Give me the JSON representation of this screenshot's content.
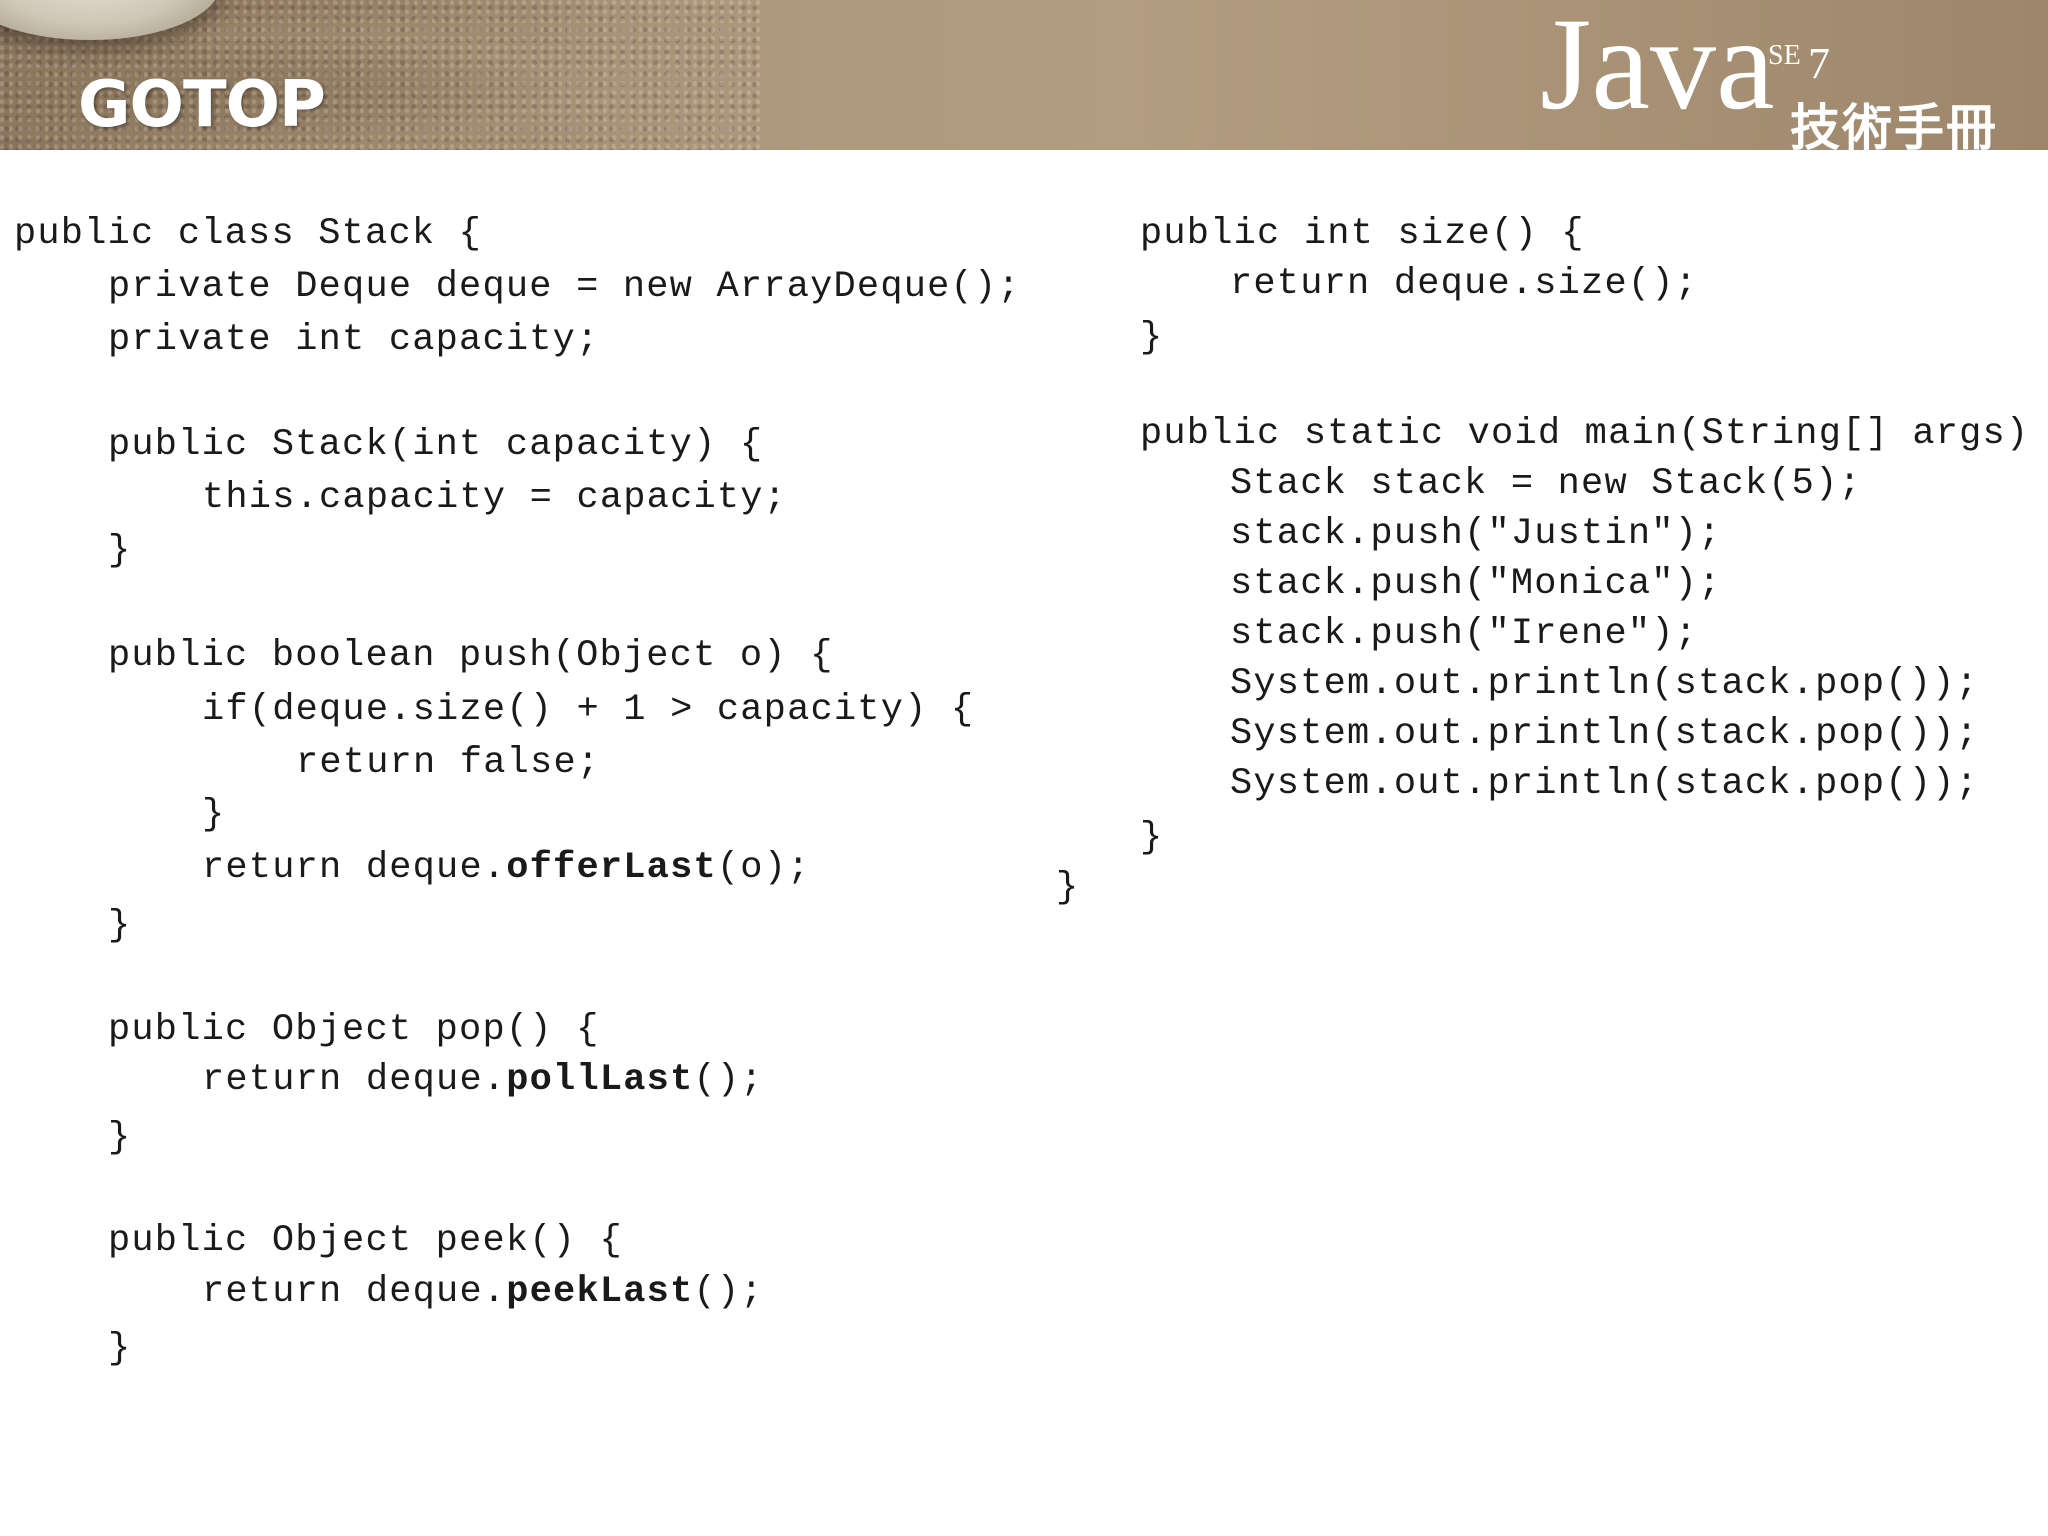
{
  "header": {
    "brand": "GOTOP",
    "product": "Java",
    "edition": "SE",
    "version": "7",
    "subtitle": "技術手冊"
  },
  "left_code": [
    {
      "indent": 0,
      "parts": [
        {
          "t": "public class Stack {"
        }
      ]
    },
    {
      "indent": 1,
      "parts": [
        {
          "t": "private Deque deque = new ArrayDeque();"
        }
      ]
    },
    {
      "indent": 1,
      "parts": [
        {
          "t": "private int capacity;"
        }
      ]
    },
    {
      "indent": 1,
      "parts": [
        {
          "t": "public Stack(int capacity) {"
        }
      ]
    },
    {
      "indent": 2,
      "parts": [
        {
          "t": "this.capacity = capacity;"
        }
      ]
    },
    {
      "indent": 1,
      "parts": [
        {
          "t": "}"
        }
      ]
    },
    {
      "indent": 1,
      "parts": [
        {
          "t": "public boolean push(Object o) {"
        }
      ]
    },
    {
      "indent": 2,
      "parts": [
        {
          "t": "if(deque.size() + 1 > capacity) {"
        }
      ]
    },
    {
      "indent": 3,
      "parts": [
        {
          "t": "return false;"
        }
      ]
    },
    {
      "indent": 2,
      "parts": [
        {
          "t": "}"
        }
      ]
    },
    {
      "indent": 2,
      "parts": [
        {
          "t": "return deque."
        },
        {
          "t": "offerLast",
          "b": true
        },
        {
          "t": "(o);"
        }
      ]
    },
    {
      "indent": 1,
      "parts": [
        {
          "t": "}"
        }
      ]
    },
    {
      "indent": 1,
      "parts": [
        {
          "t": "public Object pop() {"
        }
      ]
    },
    {
      "indent": 2,
      "parts": [
        {
          "t": "return deque."
        },
        {
          "t": "pollLast",
          "b": true
        },
        {
          "t": "();"
        }
      ]
    },
    {
      "indent": 1,
      "parts": [
        {
          "t": "}"
        }
      ]
    },
    {
      "indent": 1,
      "parts": [
        {
          "t": "public Object peek() {"
        }
      ]
    },
    {
      "indent": 2,
      "parts": [
        {
          "t": "return deque."
        },
        {
          "t": "peekLast",
          "b": true
        },
        {
          "t": "();"
        }
      ]
    },
    {
      "indent": 1,
      "parts": [
        {
          "t": "}"
        }
      ]
    }
  ],
  "right_code": [
    {
      "indent": 0,
      "parts": [
        {
          "t": "public int size() {"
        }
      ]
    },
    {
      "indent": 1,
      "parts": [
        {
          "t": "return deque.size();"
        }
      ]
    },
    {
      "indent": 0,
      "parts": [
        {
          "t": "}"
        }
      ]
    },
    {
      "indent": 0,
      "parts": [
        {
          "t": "public static void main(String[] args) {"
        }
      ]
    },
    {
      "indent": 1,
      "parts": [
        {
          "t": "Stack stack = new Stack(5);"
        }
      ]
    },
    {
      "indent": 1,
      "parts": [
        {
          "t": "stack.push(\"Justin\");"
        }
      ]
    },
    {
      "indent": 1,
      "parts": [
        {
          "t": "stack.push(\"Monica\");"
        }
      ]
    },
    {
      "indent": 1,
      "parts": [
        {
          "t": "stack.push(\"Irene\");"
        }
      ]
    },
    {
      "indent": 1,
      "parts": [
        {
          "t": "System.out.println(stack.pop());"
        }
      ]
    },
    {
      "indent": 1,
      "parts": [
        {
          "t": "System.out.println(stack.pop());"
        }
      ]
    },
    {
      "indent": 1,
      "parts": [
        {
          "t": "System.out.println(stack.pop());"
        }
      ]
    },
    {
      "indent": 0,
      "parts": [
        {
          "t": "}"
        }
      ]
    }
  ],
  "class_closing_brace": "}"
}
